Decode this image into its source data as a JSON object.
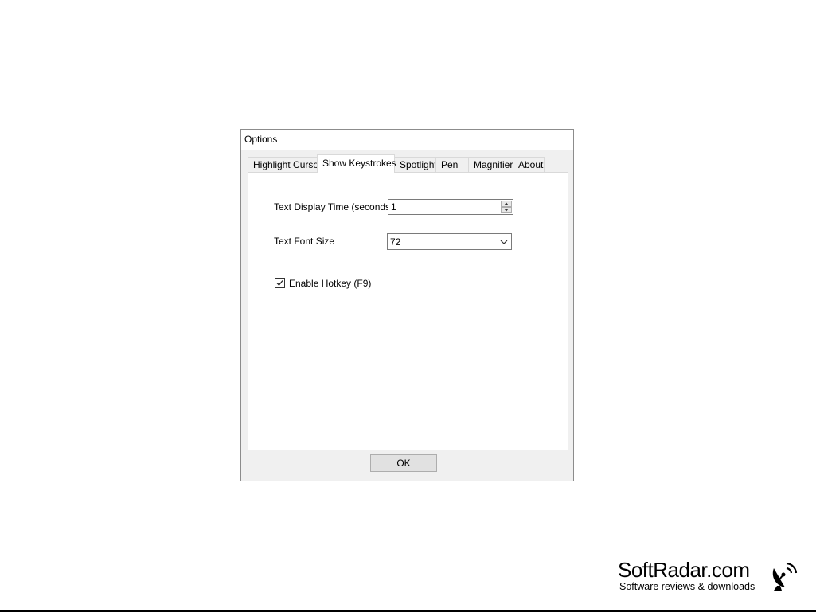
{
  "dialog": {
    "title": "Options",
    "tabs": [
      {
        "label": "Highlight Cursor"
      },
      {
        "label": "Show Keystrokes",
        "active": true
      },
      {
        "label": "Spotlight"
      },
      {
        "label": "Pen"
      },
      {
        "label": "Magnifier"
      },
      {
        "label": "About"
      }
    ],
    "text_display_time": {
      "label": "Text Display Time (seconds)",
      "value": "1"
    },
    "text_font_size": {
      "label": "Text Font Size",
      "value": "72"
    },
    "enable_hotkey": {
      "label": "Enable Hotkey (F9)",
      "checked": true
    },
    "ok_label": "OK"
  },
  "watermark": {
    "name": "SoftRadar.com",
    "tagline": "Software reviews & downloads",
    "icon": "satellite-dish-icon"
  }
}
